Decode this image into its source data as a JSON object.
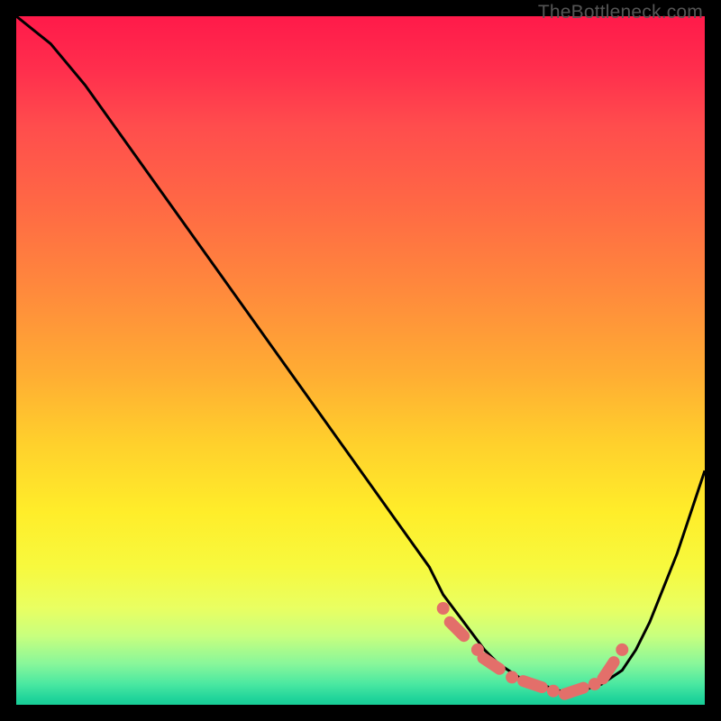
{
  "watermark": "TheBottleneck.com",
  "colors": {
    "frame": "#000000",
    "curve_stroke": "#000000",
    "marker_fill": "#e36f6a",
    "gradient_top": "#ff1a4a",
    "gradient_bottom": "#18cc96"
  },
  "chart_data": {
    "type": "line",
    "title": "",
    "xlabel": "",
    "ylabel": "",
    "xlim": [
      0,
      100
    ],
    "ylim": [
      0,
      100
    ],
    "note": "Values are estimated from pixel positions; no axis tick labels are visible.",
    "series": [
      {
        "name": "bottleneck-curve",
        "x": [
          0,
          5,
          10,
          15,
          20,
          25,
          30,
          35,
          40,
          45,
          50,
          55,
          60,
          62,
          65,
          68,
          70,
          73,
          76,
          79,
          82,
          85,
          88,
          90,
          92,
          94,
          96,
          98,
          100
        ],
        "y": [
          100,
          96,
          90,
          83,
          76,
          69,
          62,
          55,
          48,
          41,
          34,
          27,
          20,
          16,
          12,
          8,
          6,
          4,
          3,
          2,
          2,
          3,
          5,
          8,
          12,
          17,
          22,
          28,
          34
        ]
      }
    ],
    "markers": {
      "name": "highlight-points",
      "x": [
        62,
        64,
        67,
        69,
        72,
        75,
        78,
        81,
        84,
        86,
        88
      ],
      "y": [
        14,
        11,
        8,
        6,
        4,
        3,
        2,
        2,
        3,
        5,
        8
      ]
    }
  }
}
